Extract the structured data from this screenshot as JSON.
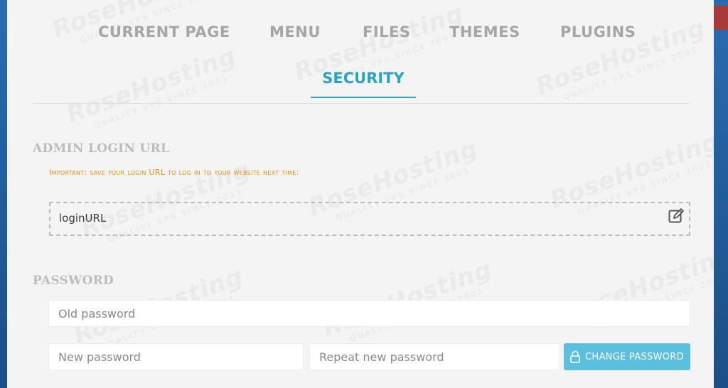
{
  "tabs": {
    "current_page": "CURRENT PAGE",
    "menu": "MENU",
    "files": "FILES",
    "themes": "THEMES",
    "plugins": "PLUGINS",
    "security": "SECURITY"
  },
  "admin_login": {
    "title": "ADMIN LOGIN URL",
    "note": "Important: save your login URL to log in to your website next time:",
    "value": "loginURL",
    "edit_icon": "edit-icon"
  },
  "password": {
    "title": "PASSWORD",
    "old_placeholder": "Old password",
    "new_placeholder": "New password",
    "repeat_placeholder": "Repeat new password",
    "change_label": "CHANGE PASSWORD",
    "lock_icon": "lock-icon"
  },
  "watermark": {
    "brand": "RoseHosting",
    "tagline": "QUALITY VPS SINCE 2001"
  },
  "colors": {
    "accent": "#2ba4c4",
    "button": "#5bc0de",
    "warning": "#e38e1a",
    "muted": "#a6a6a6"
  }
}
